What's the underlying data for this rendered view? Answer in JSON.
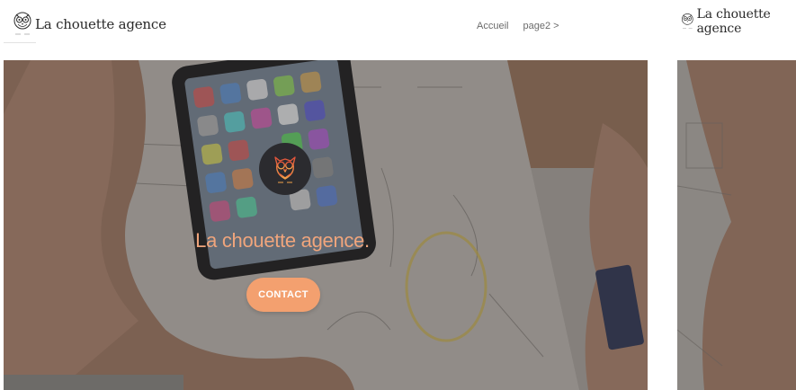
{
  "brand": {
    "name": "La chouette agence"
  },
  "nav": {
    "items": [
      "Accueil",
      "page2 >"
    ]
  },
  "hero": {
    "title": "La chouette agence.",
    "cta_label": "CONTACT"
  },
  "secondary": {
    "brand_name": "La chouette agence"
  },
  "colors": {
    "accent": "#f3a06f",
    "title": "#f0a57c",
    "emblem_bg": "#2b2b2f"
  },
  "icons": {
    "logo": "owl-logo-icon",
    "emblem": "owl-emblem-icon"
  }
}
